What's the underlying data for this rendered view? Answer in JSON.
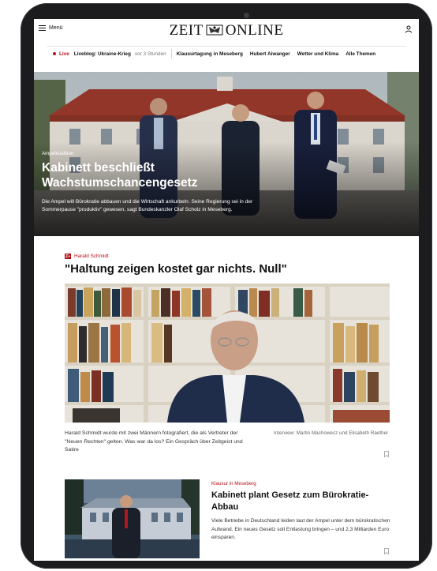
{
  "header": {
    "menu_label": "Menü",
    "logo_left": "ZEIT",
    "logo_right": "ONLINE"
  },
  "nav": {
    "live_label": "Live",
    "live_item": "Liveblog: Ukraine-Krieg",
    "live_time": "vor 3 Stunden",
    "items": [
      "Klausurtagung in Meseberg",
      "Hubert Aiwanger",
      "Wetter und Klima",
      "Alle Themen"
    ]
  },
  "hero": {
    "kicker": "Ampelkoalition",
    "title": "Kabinett beschließt Wachstumschancengesetz",
    "teaser": "Die Ampel will Bürokratie abbauen und die Wirtschaft ankurbeln. Seine Regierung sei in der Sommerpause \"produktiv\" gewesen, sagt Bundeskanzler Olaf Scholz in Meseberg."
  },
  "article1": {
    "badge": "Z+",
    "kicker": "Harald Schmidt",
    "title": "\"Haltung zeigen kostet gar nichts. Null\"",
    "teaser": "Harald Schmidt wurde mit zwei Männern fotografiert, die als Vertreter der \"Neuen Rechten\" gelten. Was war da los? Ein Gespräch über Zeitgeist und Satire",
    "credit": "Interview: Martin Machowecz und Elisabeth Raether"
  },
  "article2": {
    "kicker": "Klausur in Meseberg",
    "title": "Kabinett plant Gesetz zum Bürokratie-Abbau",
    "teaser": "Viele Betriebe in Deutschland leiden laut der Ampel unter dem bürokratischen Aufwand. Ein neues Gesetz soll Entlastung bringen – und 2,3 Milliarden Euro einsparen."
  },
  "colors": {
    "accent": "#b5121b",
    "device": "#1c1c1e"
  },
  "icons": [
    "hamburger-icon",
    "user-icon",
    "live-dot-icon",
    "bookmark-icon"
  ]
}
